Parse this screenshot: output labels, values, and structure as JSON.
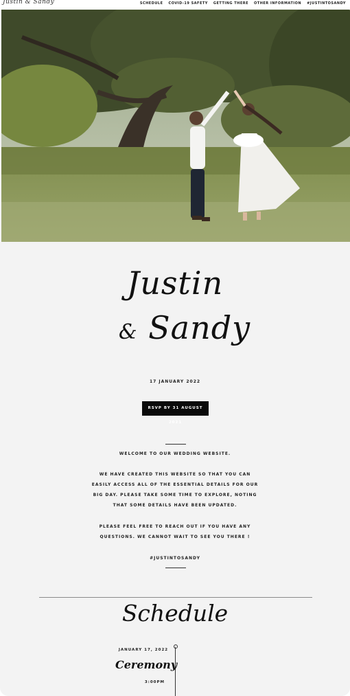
{
  "nav": {
    "logo": "Justin & Sandy",
    "items": [
      "SCHEDULE",
      "COVID-19 SAFETY",
      "GETTING THERE",
      "OTHER INFORMATION",
      "#JUSTINTOSANDY"
    ]
  },
  "hero": {
    "alt": "couple dancing under a tree"
  },
  "couple": {
    "name1": "Justin",
    "amp": "&",
    "name2": "Sandy"
  },
  "date": "17 JANUARY 2022",
  "rsvp_button": "RSVP BY 31 AUGUST 2021",
  "welcome": {
    "heading": "WELCOME TO OUR WEDDING WEBSITE.",
    "p1": [
      "WE HAVE CREATED THIS WEBSITE SO THAT YOU CAN",
      "EASILY ACCESS ALL OF THE ESSENTIAL DETAILS FOR OUR",
      "BIG DAY. PLEASE TAKE SOME TIME TO EXPLORE, NOTING",
      "THAT SOME DETAILS HAVE BEEN UPDATED."
    ],
    "p2": [
      "PLEASE FEEL FREE TO REACH OUT IF YOU HAVE ANY",
      "QUESTIONS. WE CANNOT WAIT TO SEE YOU THERE !"
    ],
    "hashtag": "#JUSTINTOSANDY"
  },
  "schedule": {
    "title": "Schedule",
    "event": {
      "date": "JANUARY 17, 2022",
      "name": "Ceremony",
      "time": "3:00PM"
    }
  }
}
